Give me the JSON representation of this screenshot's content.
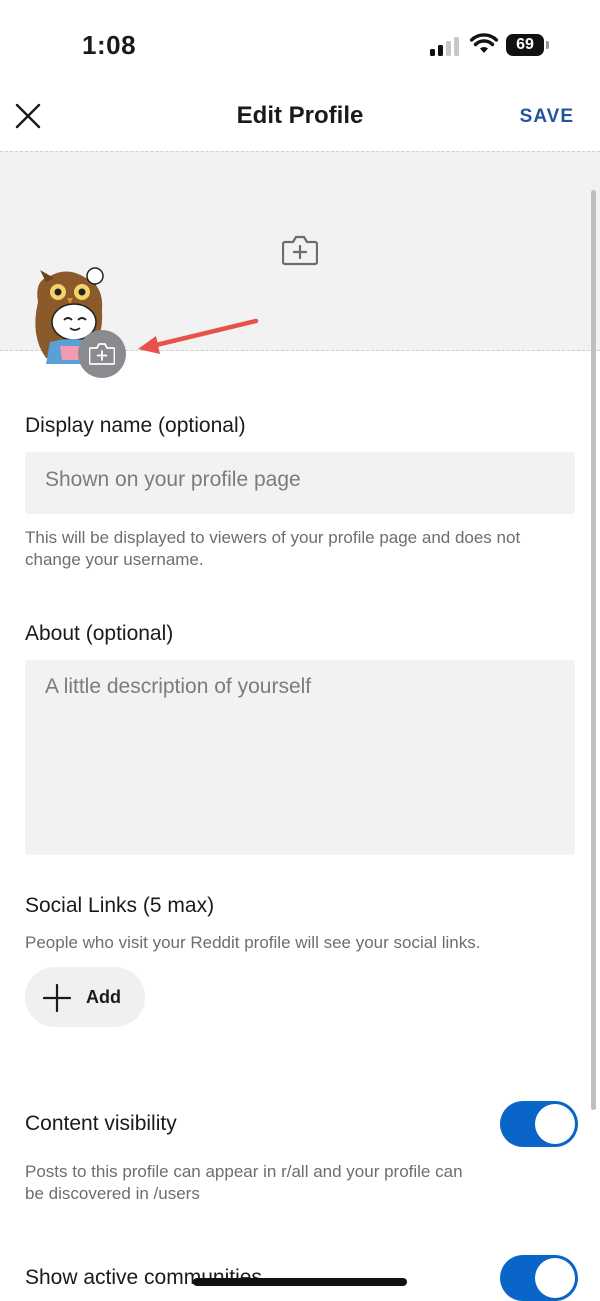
{
  "status": {
    "time": "1:08",
    "battery": "69"
  },
  "nav": {
    "title": "Edit Profile",
    "save_label": "SAVE"
  },
  "icons": {
    "close": "close-icon",
    "banner_camera": "camera-plus-icon",
    "avatar_camera": "camera-plus-icon",
    "add": "plus-icon"
  },
  "form": {
    "display_name": {
      "label": "Display name (optional)",
      "placeholder": "Shown on your profile page",
      "help": "This will be displayed to viewers of your profile page and does not change your username."
    },
    "about": {
      "label": "About (optional)",
      "placeholder": "A little description of yourself"
    },
    "social": {
      "label": "Social Links (5 max)",
      "help": "People who visit your Reddit profile will see your social links.",
      "add_label": "Add"
    },
    "content_visibility": {
      "label": "Content visibility",
      "help": "Posts to this profile can appear in r/all and your profile can be discovered in /users",
      "enabled": true
    },
    "active_communities": {
      "label": "Show active communities",
      "enabled": true
    }
  },
  "colors": {
    "accent": "#0a65c8",
    "save": "#24539c",
    "annotation_arrow": "#e8524a",
    "field_bg": "#f2f2f3"
  }
}
